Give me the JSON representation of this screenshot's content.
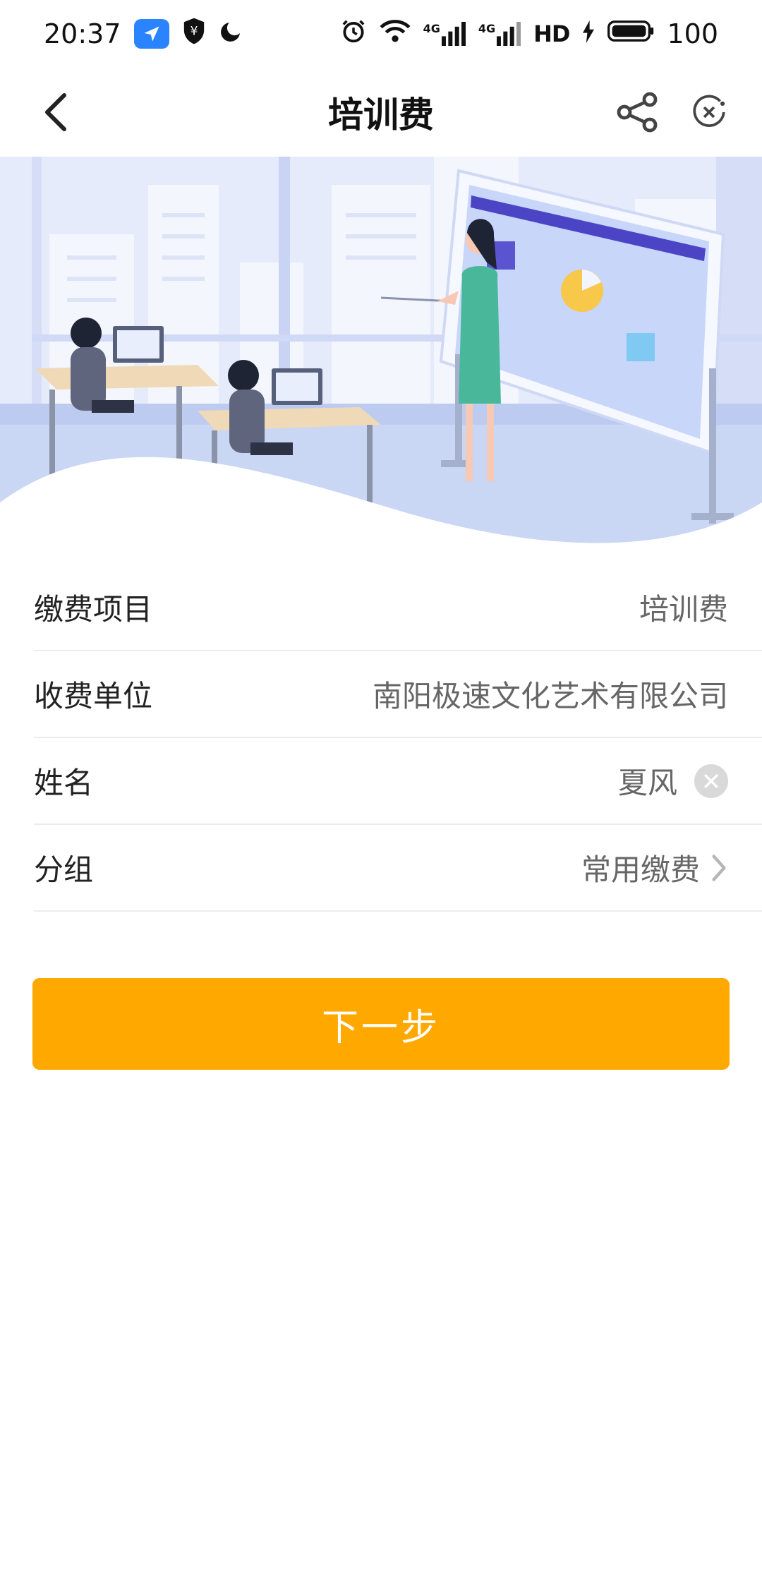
{
  "status_bar": {
    "time": "20:37",
    "network_a": "4G",
    "network_b": "4G",
    "hd_label": "HD",
    "battery": "100"
  },
  "nav": {
    "title": "培训费"
  },
  "form": {
    "rows": [
      {
        "label": "缴费项目",
        "value": "培训费"
      },
      {
        "label": "收费单位",
        "value": "南阳极速文化艺术有限公司"
      },
      {
        "label": "姓名",
        "value": "夏风"
      },
      {
        "label": "分组",
        "value": "常用缴费"
      }
    ]
  },
  "next_button": {
    "label": "下一步"
  },
  "colors": {
    "accent": "#ffa800",
    "banner_bg": "#e3e9fb",
    "banner_floor": "#c9d6f4"
  }
}
